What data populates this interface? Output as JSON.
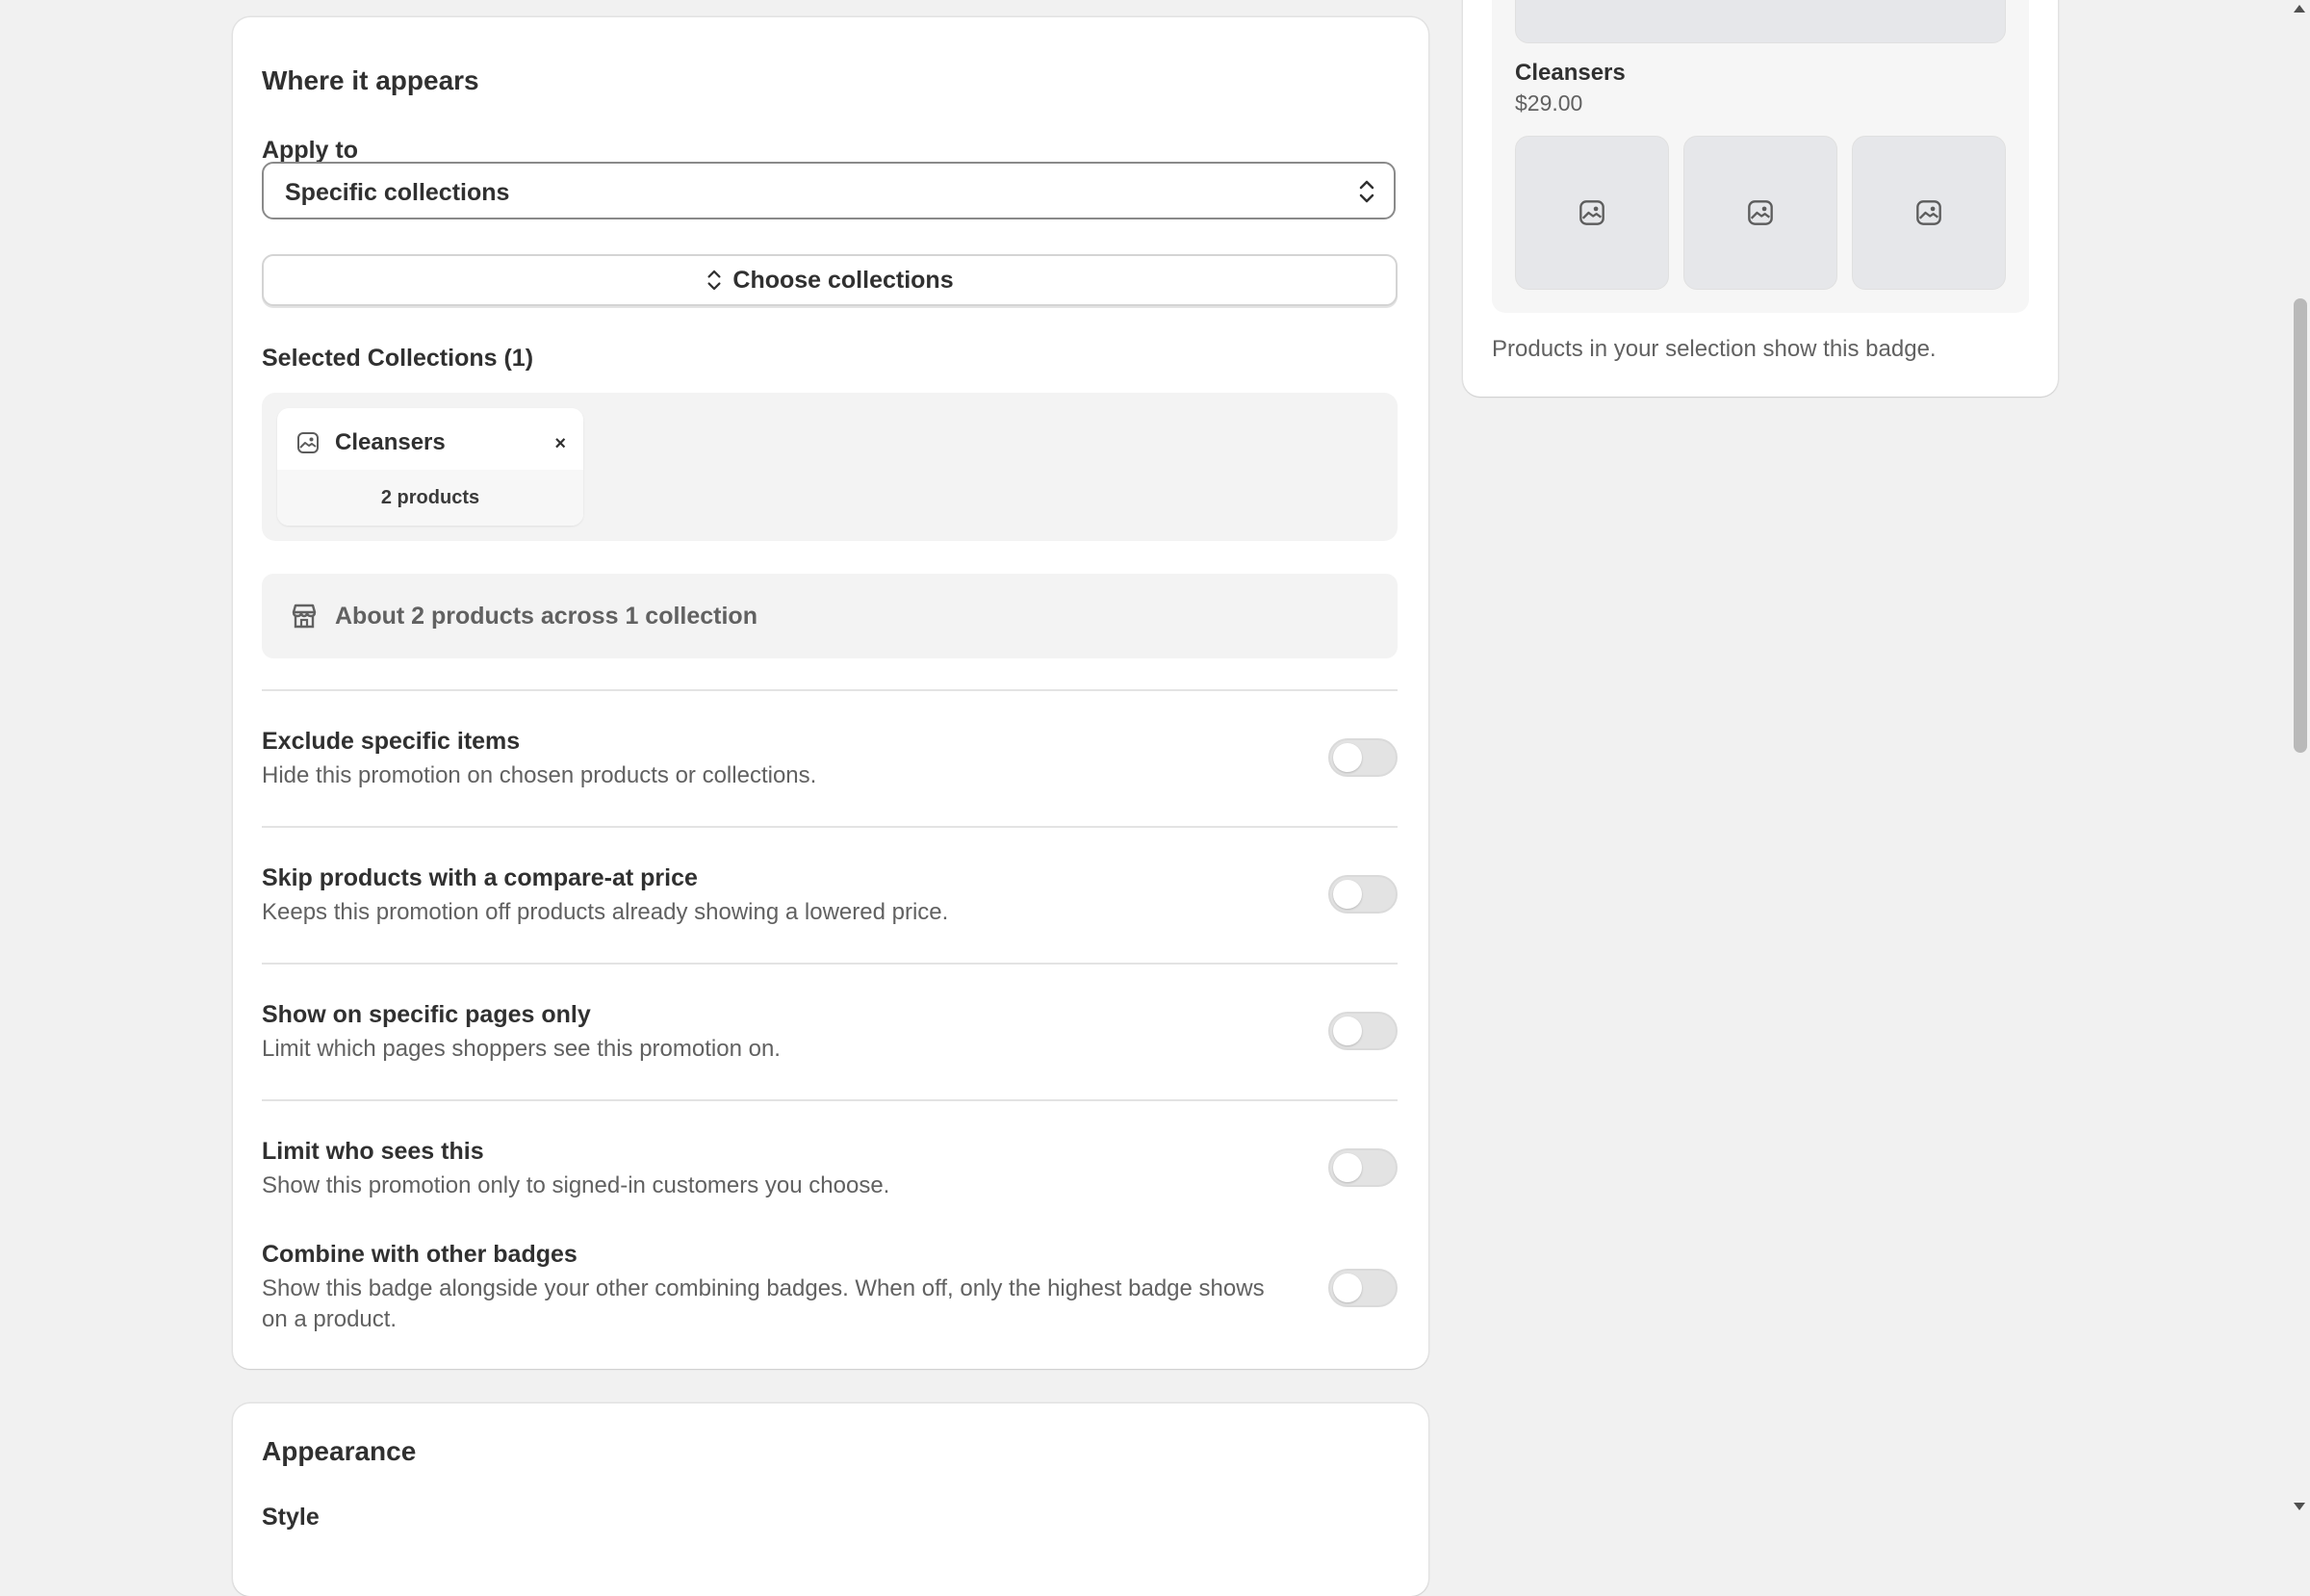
{
  "where_it_appears": {
    "title": "Where it appears",
    "apply_to_label": "Apply to",
    "apply_to_value": "Specific collections",
    "choose_button_label": "Choose collections",
    "selected_heading": "Selected Collections (1)",
    "selected_collections": [
      {
        "name": "Cleansers",
        "count": "2 products",
        "remove": "×"
      }
    ],
    "summary_text": "About 2 products across 1 collection",
    "options": [
      {
        "title": "Exclude specific items",
        "description": "Hide this promotion on chosen products or collections.",
        "enabled": false
      },
      {
        "title": "Skip products with a compare-at price",
        "description": "Keeps this promotion off products already showing a lowered price.",
        "enabled": false
      },
      {
        "title": "Show on specific pages only",
        "description": "Limit which pages shoppers see this promotion on.",
        "enabled": false
      },
      {
        "title": "Limit who sees this",
        "description": "Show this promotion only to signed-in customers you choose.",
        "enabled": false
      },
      {
        "title": "Combine with other badges",
        "description": "Show this badge alongside your other combining badges. When off, only the highest badge shows on a product.",
        "enabled": false
      }
    ]
  },
  "appearance": {
    "title": "Appearance",
    "next_label": "Style"
  },
  "preview": {
    "product_name": "Cleansers",
    "product_price": "$29.00",
    "thumbnail_icon": "image-icon",
    "caption": "Products in your selection show this badge."
  },
  "colors": {
    "page_bg": "#f1f1f1",
    "card_bg": "#ffffff",
    "text_primary": "#303030",
    "text_secondary": "#616161",
    "toggle_off": "#e3e3e3"
  }
}
